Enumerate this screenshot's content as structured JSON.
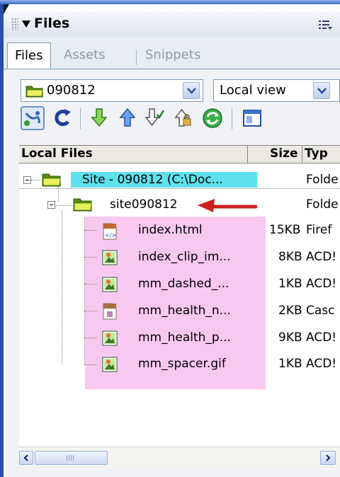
{
  "panel": {
    "title": "Files"
  },
  "tabs": [
    {
      "label": "Files"
    },
    {
      "label": "Assets"
    },
    {
      "label": "Snippets"
    }
  ],
  "site_selector": {
    "value": "090812"
  },
  "view_selector": {
    "value": "Local view"
  },
  "toolbar": {
    "buttons": [
      "connect-icon",
      "refresh-icon",
      "get-files-icon",
      "put-files-icon",
      "check-out-icon",
      "check-in-icon",
      "synchronize-icon",
      "expand-icon"
    ]
  },
  "list": {
    "columns": [
      "Local Files",
      "Size",
      "Typ"
    ],
    "rows": [
      {
        "name": "Site - 090812 (C:\\Doc...",
        "size": "",
        "type": "Folde"
      },
      {
        "name": "site090812",
        "size": "",
        "type": "Folde"
      },
      {
        "name": "index.html",
        "size": "15KB",
        "type": "Firef"
      },
      {
        "name": "index_clip_im...",
        "size": "8KB",
        "type": "ACD!"
      },
      {
        "name": "mm_dashed_...",
        "size": "1KB",
        "type": "ACD!"
      },
      {
        "name": "mm_health_n...",
        "size": "2KB",
        "type": "Casc"
      },
      {
        "name": "mm_health_p...",
        "size": "9KB",
        "type": "ACD!"
      },
      {
        "name": "mm_spacer.gif",
        "size": "1KB",
        "type": "ACD!"
      }
    ]
  },
  "colors": {
    "site_highlight": "#5fe0ec",
    "files_highlight": "#f8c8f0",
    "annotation_arrow": "#cc1f1f",
    "panel_border": "#2b4fa6"
  }
}
